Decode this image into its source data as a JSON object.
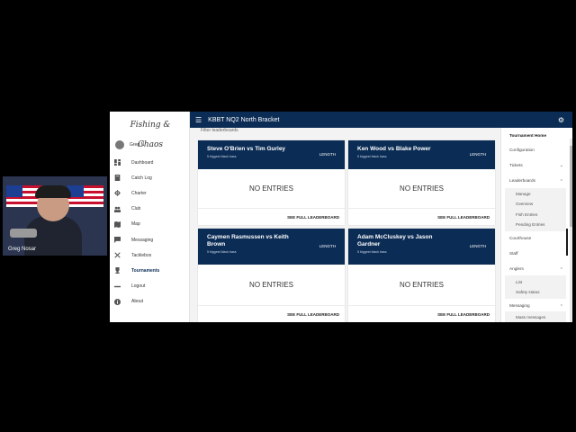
{
  "webcam": {
    "name": "Greg Nosar"
  },
  "app": {
    "logo": "Fishing & Chaos",
    "user": "Greg N.",
    "nav": [
      {
        "label": "Dashboard",
        "icon": "dashboard-icon"
      },
      {
        "label": "Catch Log",
        "icon": "catch-log-icon"
      },
      {
        "label": "Charter",
        "icon": "charter-icon"
      },
      {
        "label": "Club",
        "icon": "club-icon"
      },
      {
        "label": "Map",
        "icon": "map-icon"
      },
      {
        "label": "Messaging",
        "icon": "messaging-icon"
      },
      {
        "label": "Tacklebox",
        "icon": "tacklebox-icon"
      },
      {
        "label": "Tournaments",
        "icon": "trophy-icon",
        "active": true
      },
      {
        "label": "Logout",
        "icon": "logout-icon"
      },
      {
        "label": "About",
        "icon": "about-icon"
      }
    ],
    "topbar": {
      "title": "KBBT NQ2 North Bracket"
    },
    "filter_label": "Filter leaderboards",
    "cards": [
      {
        "title": "Steve O'Brien vs Tim Gurley",
        "subtitle": "5 biggest black bass",
        "metric": "LENGTH",
        "empty": "NO ENTRIES",
        "link": "SEE FULL LEADERBOARD"
      },
      {
        "title": "Ken Wood vs Blake Power",
        "subtitle": "5 biggest black bass",
        "metric": "LENGTH",
        "empty": "NO ENTRIES",
        "link": "SEE FULL LEADERBOARD"
      },
      {
        "title": "Caymen Rasmussen vs Keith Brown",
        "subtitle": "5 biggest black bass",
        "metric": "LENGTH",
        "empty": "NO ENTRIES",
        "link": "SEE FULL LEADERBOARD"
      },
      {
        "title": "Adam McCluskey vs Jason Gardner",
        "subtitle": "5 biggest black bass",
        "metric": "LENGTH",
        "empty": "NO ENTRIES",
        "link": "SEE FULL LEADERBOARD"
      }
    ],
    "right_nav": {
      "tournament_home": "Tournament Home",
      "configuration": "Configuration",
      "tickets": "Tickets",
      "leaderboards": "Leaderboards",
      "leaderboard_items": [
        "Manage",
        "Overview",
        "Fish Entries",
        "Pending Entries"
      ],
      "courthouse": "Courthouse",
      "staff": "Staff",
      "anglers": "Anglers",
      "angler_items": [
        "List",
        "Safety status"
      ],
      "messaging": "Messaging",
      "messaging_items": [
        "Mass messages"
      ]
    }
  }
}
